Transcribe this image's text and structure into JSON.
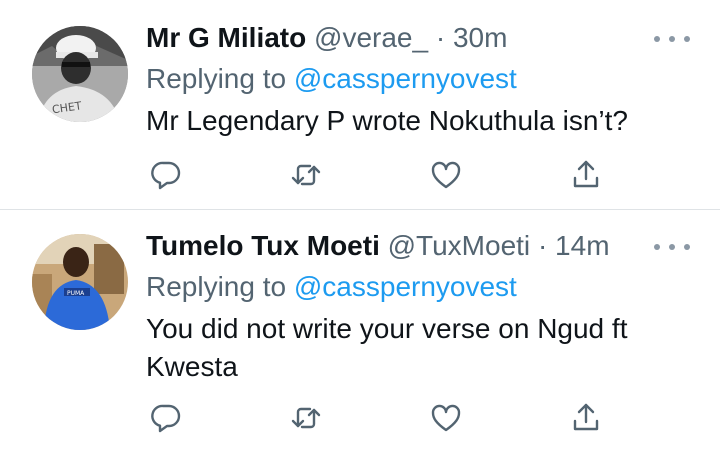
{
  "tweets": [
    {
      "name": "Mr G Miliato",
      "handle": "@verae_",
      "separator": "·",
      "time": "30m",
      "replying_prefix": "Replying to",
      "replying_to": "@casspernyovest",
      "text": "Mr Legendary P wrote Nokuthula isn’t?",
      "avatar_text": "CHET"
    },
    {
      "name": "Tumelo Tux Moeti",
      "handle": "@TuxMoeti",
      "separator": "·",
      "time": "14m",
      "replying_prefix": "Replying to",
      "replying_to": "@casspernyovest",
      "text": "You did not write your verse on Ngud ft Kwesta",
      "avatar_text": "PUMA"
    }
  ],
  "icons": {
    "reply": "reply-icon",
    "retweet": "retweet-icon",
    "like": "heart-icon",
    "share": "share-icon",
    "more": "more-icon"
  },
  "colors": {
    "text": "#0f1419",
    "secondary": "#536471",
    "mention": "#1d9bf0",
    "divider": "#dfe3e6"
  }
}
